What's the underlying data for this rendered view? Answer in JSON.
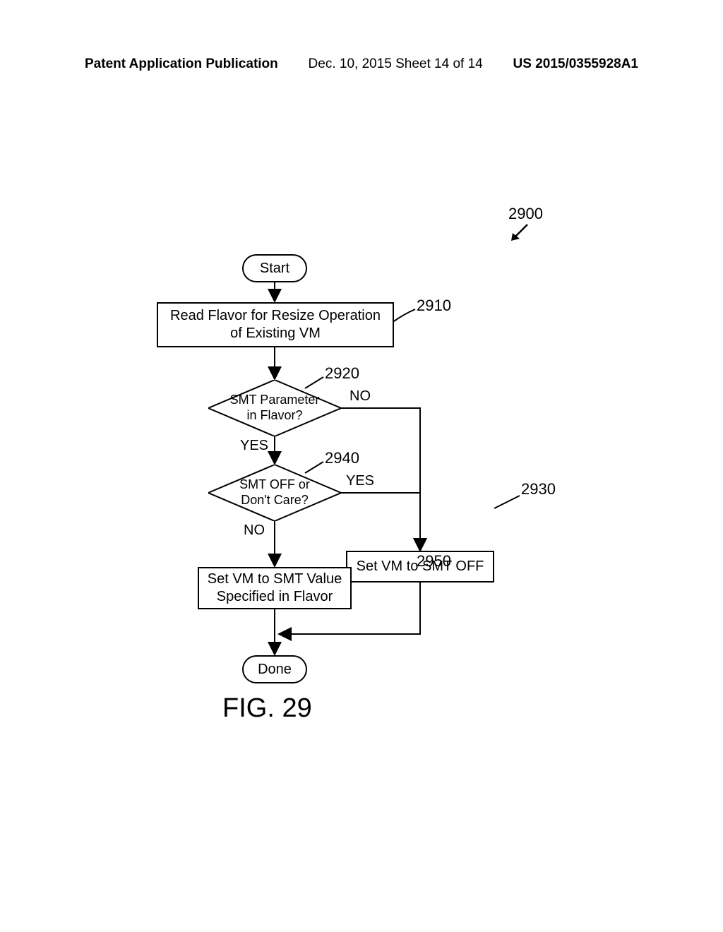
{
  "header": {
    "left": "Patent Application Publication",
    "center": "Dec. 10, 2015  Sheet 14 of 14",
    "right": "US 2015/0355928A1"
  },
  "refs": {
    "diagram": "2900",
    "step_read": "2910",
    "dec_smt_param": "2920",
    "step_set_off": "2930",
    "dec_smt_off": "2940",
    "step_set_value": "2950"
  },
  "nodes": {
    "start": "Start",
    "read_flavor": "Read Flavor for Resize Operation of Existing VM",
    "smt_param_q": "SMT Parameter in Flavor?",
    "smt_off_q": "SMT OFF or Don't Care?",
    "set_off": "Set VM to SMT OFF",
    "set_value": "Set VM to SMT Value Specified in Flavor",
    "done": "Done"
  },
  "branches": {
    "yes": "YES",
    "no": "NO"
  },
  "figure": "FIG. 29",
  "chart_data": {
    "type": "flowchart",
    "title": "FIG. 29",
    "reference": "2900",
    "nodes": [
      {
        "id": "start",
        "type": "terminal",
        "label": "Start"
      },
      {
        "id": "n2910",
        "type": "process",
        "label": "Read Flavor for Resize Operation of Existing VM",
        "ref": "2910"
      },
      {
        "id": "n2920",
        "type": "decision",
        "label": "SMT Parameter in Flavor?",
        "ref": "2920"
      },
      {
        "id": "n2940",
        "type": "decision",
        "label": "SMT OFF or Don't Care?",
        "ref": "2940"
      },
      {
        "id": "n2930",
        "type": "process",
        "label": "Set VM to SMT OFF",
        "ref": "2930"
      },
      {
        "id": "n2950",
        "type": "process",
        "label": "Set VM to SMT Value Specified in Flavor",
        "ref": "2950"
      },
      {
        "id": "done",
        "type": "terminal",
        "label": "Done"
      }
    ],
    "edges": [
      {
        "from": "start",
        "to": "n2910"
      },
      {
        "from": "n2910",
        "to": "n2920"
      },
      {
        "from": "n2920",
        "to": "n2940",
        "label": "YES"
      },
      {
        "from": "n2920",
        "to": "n2930",
        "label": "NO"
      },
      {
        "from": "n2940",
        "to": "n2930",
        "label": "YES"
      },
      {
        "from": "n2940",
        "to": "n2950",
        "label": "NO"
      },
      {
        "from": "n2930",
        "to": "done"
      },
      {
        "from": "n2950",
        "to": "done"
      }
    ]
  }
}
